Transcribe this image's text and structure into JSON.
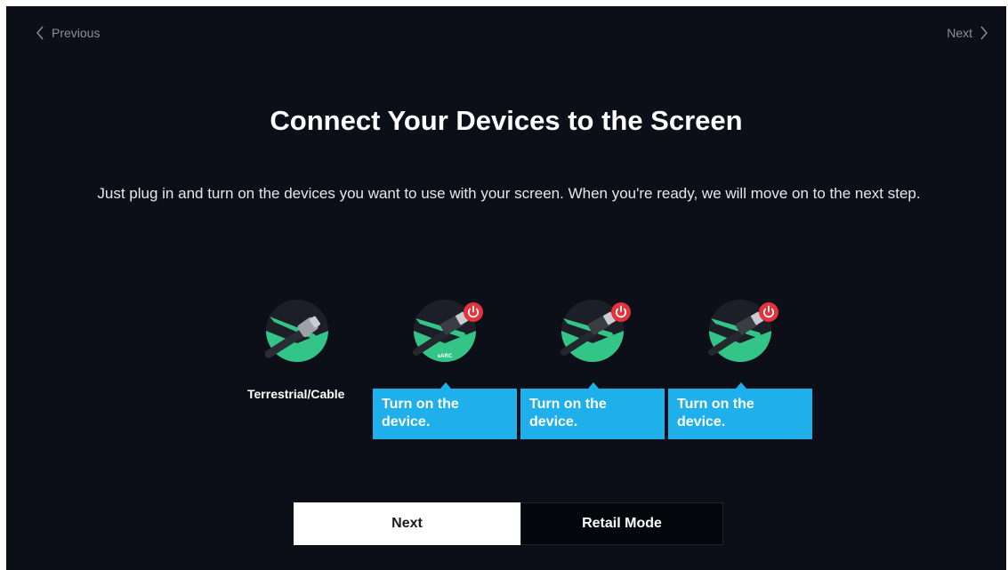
{
  "nav": {
    "previous_label": "Previous",
    "next_label": "Next"
  },
  "title": "Connect Your Devices to the Screen",
  "subtitle": "Just plug in and turn on the devices you want to use with your screen. When you're ready, we will move on to the next step.",
  "devices": [
    {
      "icon": "coax-cable-icon",
      "label": "Terrestrial/Cable"
    },
    {
      "icon": "hdmi-earc-icon",
      "port_label": "eARC",
      "status_icon": "power-icon",
      "tip": "Turn on the device."
    },
    {
      "icon": "hdmi-icon",
      "status_icon": "power-icon",
      "tip": "Turn on the device."
    },
    {
      "icon": "hdmi-icon",
      "status_icon": "power-icon",
      "tip": "Turn on the device."
    }
  ],
  "buttons": {
    "next_label": "Next",
    "retail_label": "Retail Mode"
  },
  "colors": {
    "background": "#0d0f18",
    "accent_green": "#33c588",
    "tip_blue": "#1fb0ec",
    "power_red": "#e5323b"
  }
}
